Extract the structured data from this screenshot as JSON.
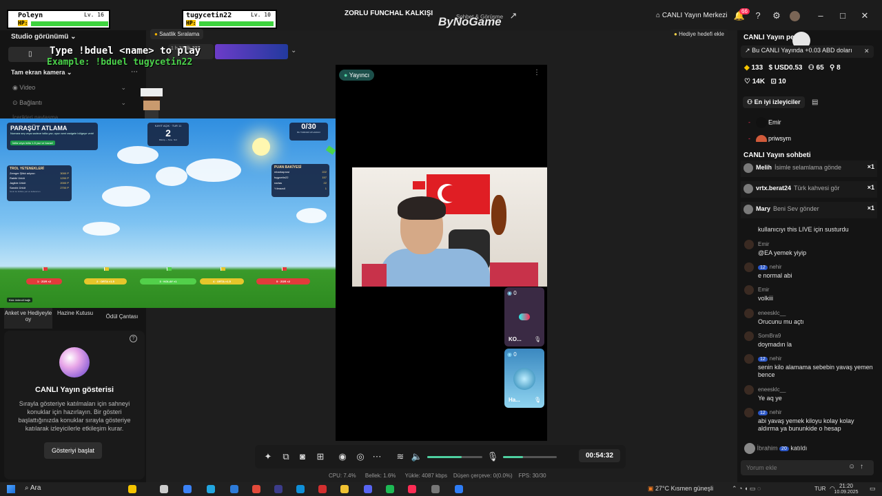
{
  "overlay": {
    "player1_name": "Poleyn",
    "player1_level": "Lv. 16",
    "player2_name": "tugycetin22",
    "player2_level": "Lv. 10",
    "hp_label": "HP:",
    "instruction": "Type !bduel <name> to play",
    "example": "Example: !bduel tugycetin22"
  },
  "titlebar": {
    "center_title": "ZORLU FUNCHAL KALKIŞI",
    "center_sub": "Sohbet & Görüşme",
    "watermark": "ByNoGame",
    "live_center": "CANLI Yayın Merkezi",
    "notif_count": "66"
  },
  "left": {
    "studio_view": "Studio görünümü",
    "hourly_rank": "Saatlik Sıralama",
    "fullscreen_cam": "Tam ekran kamera",
    "video": "Video",
    "connect": "Bağlantı",
    "truncated_menu": "İçerikleri paylaşma",
    "tabs": [
      "Anket ve Hediyeyle oy",
      "Hazine Kutusu",
      "Ödül Çantası"
    ],
    "show_title": "CANLI Yayın gösterisi",
    "show_desc": "Sırayla gösteriye katılmaları için sahneyi konuklar için hazırlayın. Bir gösteri başlattığınızda konuklar sırayla gösteriye katılarak izleyicilerle etkileşim kurar.",
    "show_button": "Gösteriyi başlat"
  },
  "game": {
    "title": "PARAŞÜT ATLAMA",
    "subtitle": "Numara seç veya sadece istila yaz; oyun seni rastgele bölgeye verir!",
    "subtitle_tag": "İstila veya istila 1-5 yaz ve kazan!",
    "round_label": "KAYIT AÇIK · TUR 11",
    "round_value": "2",
    "round_sub": "Bitmiş — Sıra · Sırt",
    "counter": "0/30",
    "counter_sub": "BU TURDAKİ ATLAMACI",
    "troll_title": "TROL YETENEKLERİ",
    "troll_rows": [
      [
        "Zemger Şifalı adyazı",
        "3000 P"
      ],
      [
        "Rakibi Ürküt",
        "1200 P"
      ],
      [
        "Jagilde Ürküt",
        "2000 P"
      ],
      [
        "Sandık Ürküt",
        "2700 P"
      ]
    ],
    "troll_note": "İsmin ile birlikte yaz ve kullanırsın",
    "points_title": "PUAN BAKİYESİ",
    "points_rows": [
      [
        "mbarkaprosi",
        "222"
      ],
      [
        "tugycetin22",
        "157"
      ],
      [
        "nartas",
        "22"
      ],
      [
        "Yılmazcil",
        "1"
      ]
    ],
    "zones": [
      "1 · ZOR ×2",
      "2 · ORTA ×1.5",
      "3 · KOLAY ×1",
      "4 · ORTA ×1.5",
      "5 · ZOR ×2"
    ],
    "bottom_tag": "Kick ünlendi bağlı",
    "mini_timer": "227",
    "mini_label": "1 h 37 dk"
  },
  "stage": {
    "presenter": "Yayıncı",
    "guest1_count": "0",
    "guest1_name": "KO...",
    "guest2_count": "0",
    "guest2_name": "Ha...",
    "timer": "00:54:32"
  },
  "right": {
    "gift_goal": "Hediye hedefi ekle",
    "live_header": "CANLI Yayın pe...",
    "earning_msg": "Bu CANLI Yayında +0.03 ABD doları",
    "stats": {
      "diamonds": "133",
      "usd": "USD0.53",
      "viewers": "65",
      "follows": "8",
      "likes": "14K",
      "gifts": "10"
    },
    "top_viewers_btn": "En iyi izleyiciler",
    "top_viewers": [
      "Emir",
      "priwsym"
    ],
    "chat_header": "CANLI Yayın sohbeti",
    "gift_rows": [
      {
        "user": "Melih",
        "text": "İsimle selamlama gönde",
        "mult": "×1"
      },
      {
        "user": "vrtx.berat24",
        "text": "Türk kahvesi gör",
        "mult": "×1"
      },
      {
        "user": "Mary",
        "text": "Beni Sev gönder",
        "mult": "×1"
      }
    ],
    "chat": [
      {
        "name": "",
        "text": "kullanıcıyı this LIVE için susturdu"
      },
      {
        "name": "Emir",
        "text": "@EA yemek yiyip"
      },
      {
        "name": "nehir",
        "badge": "12",
        "text": "e normal abi"
      },
      {
        "name": "Emir",
        "text": "volkiii"
      },
      {
        "name": "eneesklc__",
        "text": "Orucunu mu açtı"
      },
      {
        "name": "SomBra9",
        "text": "doymadın la"
      },
      {
        "name": "nehir",
        "badge": "12",
        "text": "senin kilo alamama sebebin yavaş yemen bence"
      },
      {
        "name": "eneesklc__",
        "text": "Ye aq ye"
      },
      {
        "name": "nehir",
        "badge": "12",
        "text": "abi yavaş yemek kiloyu kolay kolay aldırma ya bununkide o hesap"
      }
    ],
    "join_name": "İbrahim",
    "join_badge": "20",
    "join_text": "katıldı",
    "comment_placeholder": "Yorum ekle"
  },
  "status": {
    "cpu": "CPU: 7.4%",
    "memory": "Bellek: 1.6%",
    "upload": "Yükle: 4087 kbps",
    "dropped": "Düşen çerçeve: 0(0.0%)",
    "fps": "FPS: 30/30"
  },
  "taskbar": {
    "search": "Ara",
    "weather": "27°C  Kısmen güneşli",
    "lang": "TUR",
    "time": "21:20",
    "date": "10.09.2025"
  },
  "colors": {
    "accent": "#4fd1a1",
    "hp_green": "#3ed33e",
    "live_red": "#fe2c55"
  }
}
